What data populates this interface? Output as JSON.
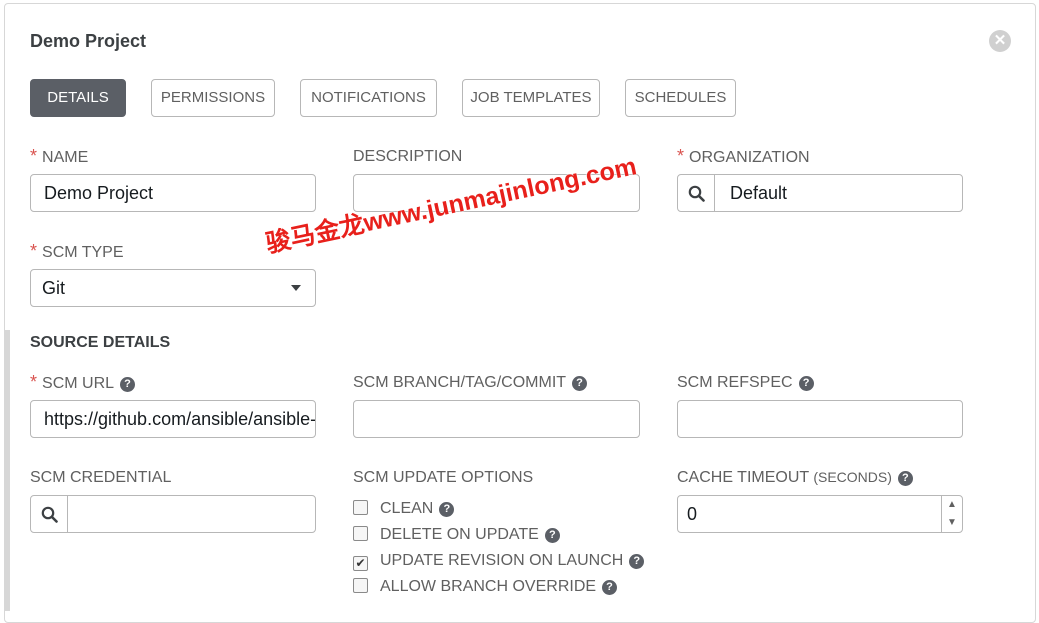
{
  "modal": {
    "title": "Demo Project",
    "close_icon": "close-icon"
  },
  "tabs": [
    {
      "label": "DETAILS",
      "active": true
    },
    {
      "label": "PERMISSIONS",
      "active": false
    },
    {
      "label": "NOTIFICATIONS",
      "active": false
    },
    {
      "label": "JOB TEMPLATES",
      "active": false
    },
    {
      "label": "SCHEDULES",
      "active": false
    }
  ],
  "fields": {
    "name": {
      "label": "NAME",
      "value": "Demo Project",
      "required": true
    },
    "description": {
      "label": "DESCRIPTION",
      "value": ""
    },
    "organization": {
      "label": "ORGANIZATION",
      "value": "Default",
      "required": true
    },
    "scm_type": {
      "label": "SCM TYPE",
      "value": "Git",
      "required": true
    }
  },
  "source_details": {
    "heading": "SOURCE DETAILS",
    "scm_url": {
      "label": "SCM URL",
      "value": "https://github.com/ansible/ansible-tower-samples",
      "required": true
    },
    "scm_branch": {
      "label": "SCM BRANCH/TAG/COMMIT",
      "value": ""
    },
    "scm_refspec": {
      "label": "SCM REFSPEC",
      "value": ""
    },
    "scm_credential": {
      "label": "SCM CREDENTIAL",
      "value": ""
    },
    "update_options": {
      "label": "SCM UPDATE OPTIONS",
      "options": [
        {
          "label": "CLEAN",
          "checked": false
        },
        {
          "label": "DELETE ON UPDATE",
          "checked": false
        },
        {
          "label": "UPDATE REVISION ON LAUNCH",
          "checked": true
        },
        {
          "label": "ALLOW BRANCH OVERRIDE",
          "checked": false
        }
      ]
    },
    "cache_timeout": {
      "label": "CACHE TIMEOUT",
      "unit": "(SECONDS)",
      "value": "0"
    }
  },
  "watermark": "骏马金龙www.junmajinlong.com",
  "colors": {
    "required": "#d9534f",
    "active_tab": "#5b5f66",
    "watermark": "#e8201b"
  }
}
